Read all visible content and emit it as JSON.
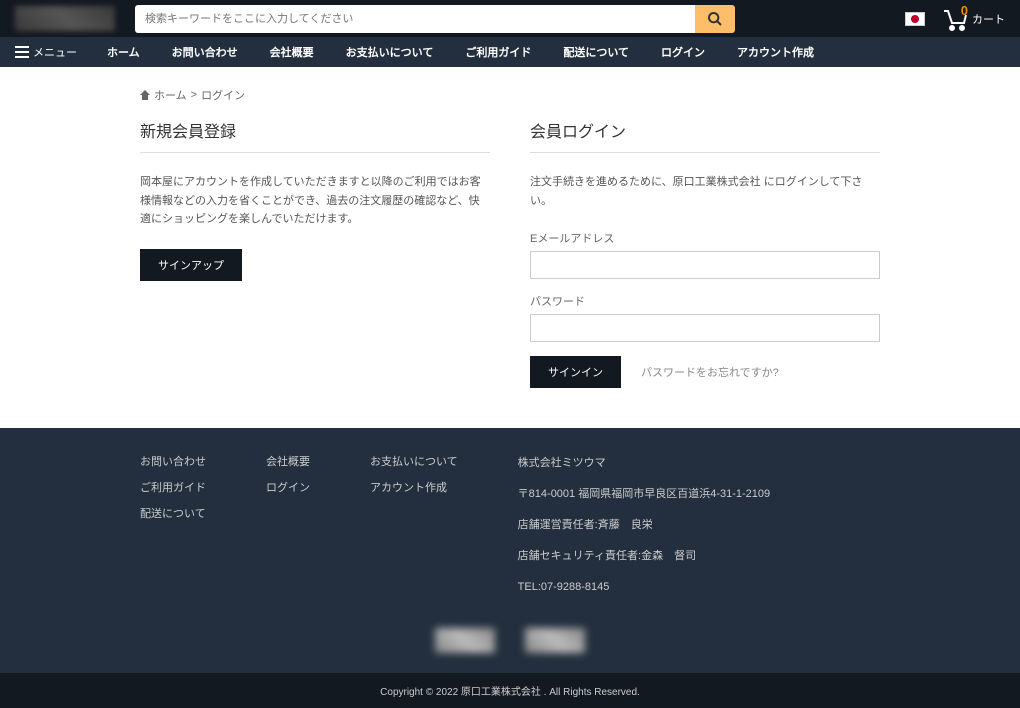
{
  "header": {
    "search_placeholder": "検索キーワードをここに入力してください",
    "cart_count": "0",
    "cart_label": "カート"
  },
  "nav": {
    "menu_label": "メニュー",
    "links": [
      "ホーム",
      "お問い合わせ",
      "会社概要",
      "お支払いについて",
      "ご利用ガイド",
      "配送について",
      "ログイン",
      "アカウント作成"
    ]
  },
  "breadcrumb": {
    "home": "ホーム",
    "current": "ログイン"
  },
  "register": {
    "title": "新規会員登録",
    "desc": "岡本屋にアカウントを作成していただきますと以降のご利用ではお客様情報などの入力を省くことができ、過去の注文履歴の確認など、快適にショッピングを楽しんでいただけます。",
    "button": "サインアップ"
  },
  "login": {
    "title": "会員ログイン",
    "desc": "注文手続きを進めるために、原口工業株式会社 にログインして下さい。",
    "email_label": "Eメールアドレス",
    "password_label": "パスワード",
    "button": "サインイン",
    "forgot": "パスワードをお忘れですか?"
  },
  "footer": {
    "col1": [
      "お問い合わせ",
      "ご利用ガイド",
      "配送について"
    ],
    "col2": [
      "会社概要",
      "ログイン"
    ],
    "col3": [
      "お支払いについて",
      "アカウント作成"
    ],
    "company": {
      "name": "株式会社ミツウマ",
      "address": "〒814-0001 福岡県福岡市早良区百道浜4-31-1-2109",
      "manager": "店舗運営責任者:斉藤　良栄",
      "security": "店舗セキュリティ責任者:金森　督司",
      "tel": "TEL:07-9288-8145"
    },
    "copyright": "Copyright © 2022 原口工業株式会社 . All Rights Reserved."
  }
}
